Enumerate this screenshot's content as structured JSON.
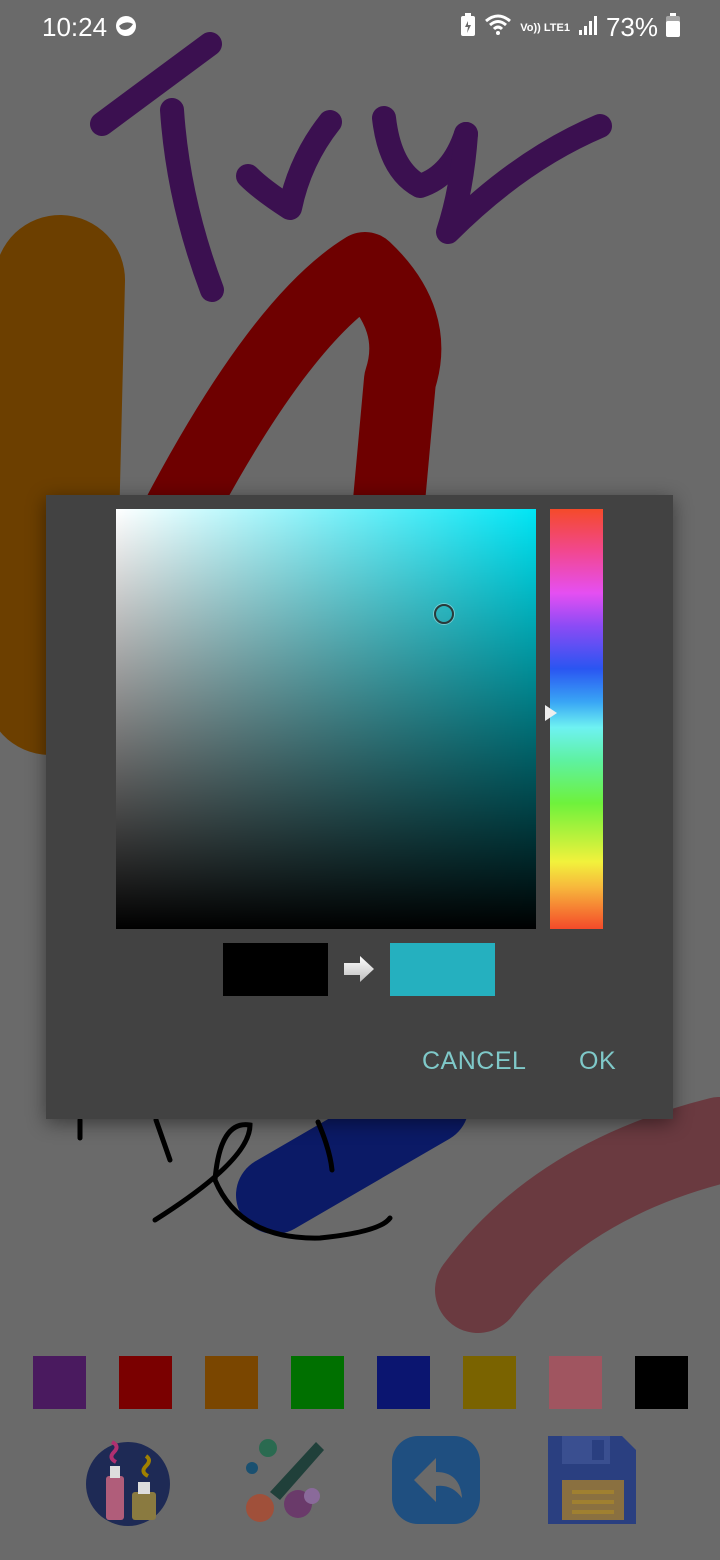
{
  "status_bar": {
    "time": "10:24",
    "network_label": "Vo)) LTE1",
    "battery_percent": "73%"
  },
  "canvas": {
    "stroke_colors": [
      "#3b1050",
      "#6e0000",
      "#6c3f00",
      "#0b1a66",
      "#6a3a40",
      "#000000"
    ]
  },
  "color_picker": {
    "hue_color": "#00e5f5",
    "old_color": "#000000",
    "new_color": "#25b0bf",
    "saturation": 0.78,
    "value": 0.75,
    "hue_degrees": 185,
    "cancel_label": "CANCEL",
    "ok_label": "OK"
  },
  "palette": {
    "colors": [
      "#4a1a5f",
      "#7a0000",
      "#7a4600",
      "#007000",
      "#0b1570",
      "#7a6300",
      "#a05560",
      "#000000"
    ]
  },
  "toolbar": {
    "buttons": [
      {
        "icon": "paint-bottles-icon"
      },
      {
        "icon": "brush-palette-icon"
      },
      {
        "icon": "undo-icon"
      },
      {
        "icon": "save-floppy-icon"
      }
    ]
  }
}
